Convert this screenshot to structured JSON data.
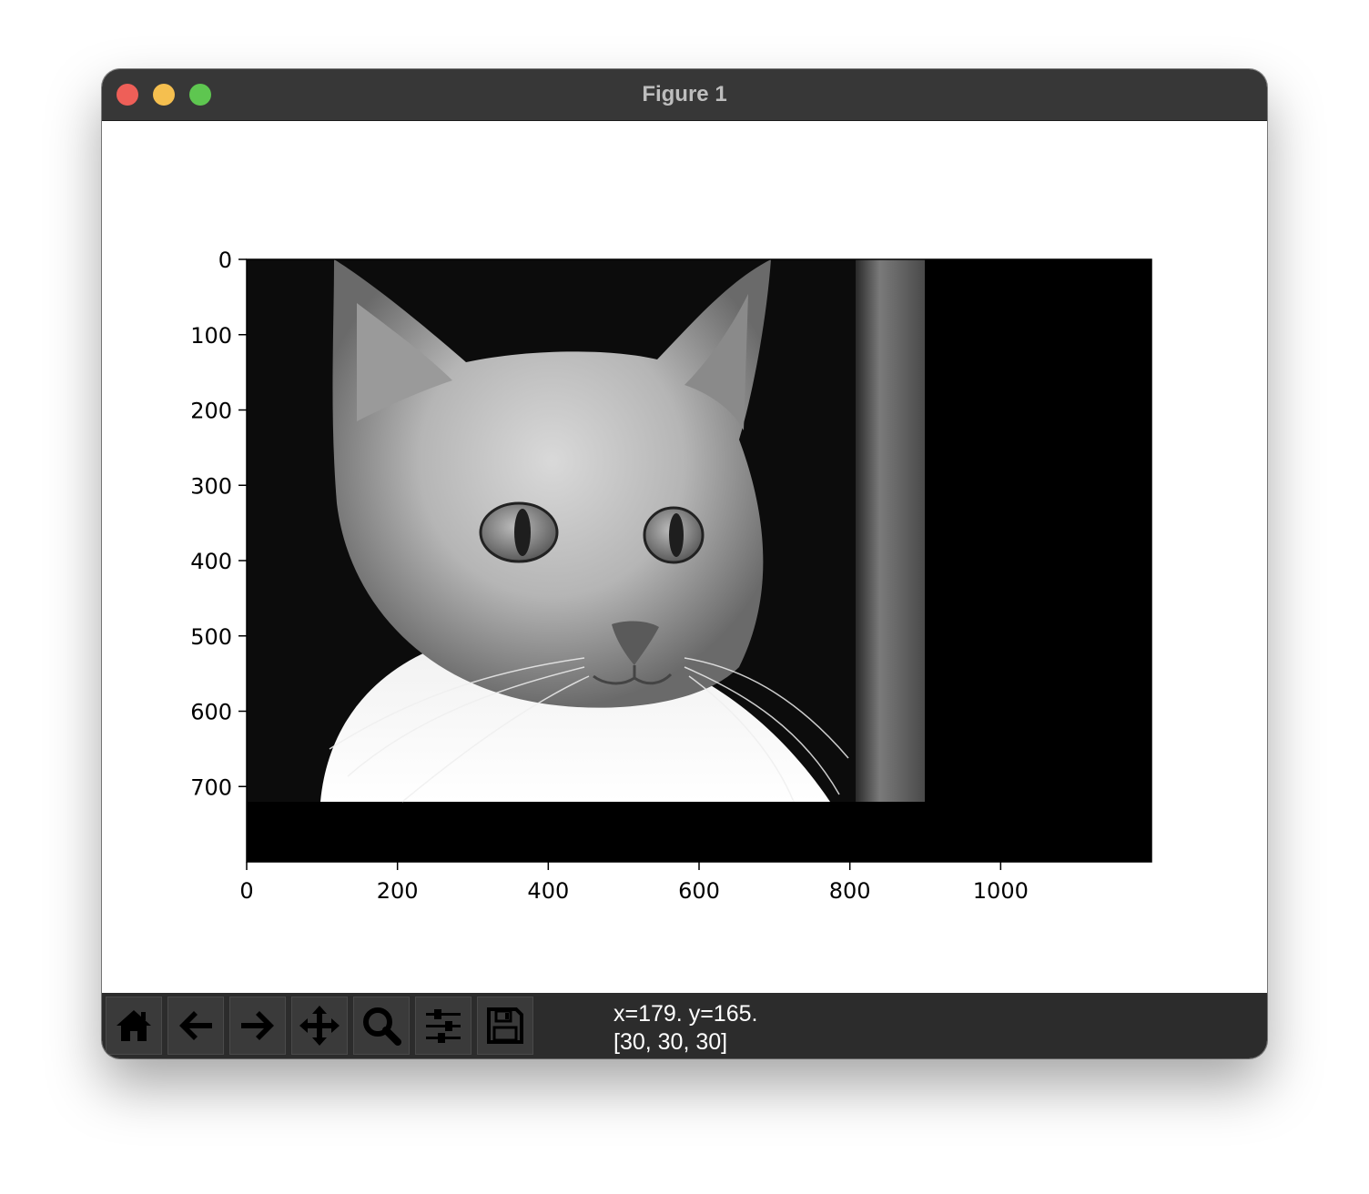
{
  "window": {
    "title": "Figure 1",
    "traffic_lights": {
      "close": "#ee5f58",
      "minimize": "#f5bf4f",
      "maximize": "#5ec650"
    }
  },
  "chart_data": {
    "type": "image",
    "image": {
      "description_colormap": "gray",
      "width": 900,
      "height": 720
    },
    "xlim": [
      0,
      1200
    ],
    "ylim": [
      800,
      0
    ],
    "xticks": [
      0,
      200,
      400,
      600,
      800,
      1000
    ],
    "yticks": [
      0,
      100,
      200,
      300,
      400,
      500,
      600,
      700
    ],
    "xtick_labels": [
      "0",
      "200",
      "400",
      "600",
      "800",
      "1000"
    ],
    "ytick_labels": [
      "0",
      "100",
      "200",
      "300",
      "400",
      "500",
      "600",
      "700"
    ],
    "background_color": "#000000"
  },
  "toolbar": {
    "buttons": [
      {
        "name": "home-button",
        "icon": "home-icon"
      },
      {
        "name": "back-button",
        "icon": "arrow-left-icon"
      },
      {
        "name": "forward-button",
        "icon": "arrow-right-icon"
      },
      {
        "name": "pan-button",
        "icon": "move-icon"
      },
      {
        "name": "zoom-button",
        "icon": "magnifier-icon"
      },
      {
        "name": "configure-subplots-button",
        "icon": "sliders-icon"
      },
      {
        "name": "save-button",
        "icon": "floppy-disk-icon"
      }
    ]
  },
  "status": {
    "coords": "x=179. y=165.",
    "pixel_value": "[30, 30, 30]"
  }
}
